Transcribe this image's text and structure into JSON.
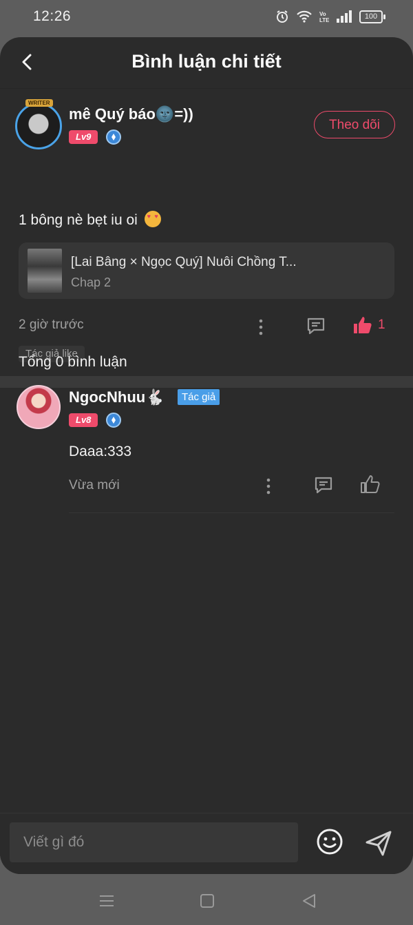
{
  "status_bar": {
    "time": "12:26",
    "battery": "100",
    "icons": [
      "alarm-icon",
      "wifi-icon",
      "volte-icon",
      "signal-icon",
      "battery-icon"
    ]
  },
  "header": {
    "title": "Bình luận chi tiết",
    "back_icon": "chevron-left-icon"
  },
  "post": {
    "username": "mê Quý báo🌚=))",
    "avatar_badge": "WRITER",
    "level": "Lv9",
    "follow_label": "Theo dõi",
    "text": "1 bông nè bẹt iu oi",
    "emoji": "heart-eyes-cat-emoji",
    "story": {
      "title": "[Lai Bâng × Ngọc Quý] Nuôi Chồng T...",
      "chapter": "Chap 2"
    },
    "time_ago": "2 giờ trước",
    "like_count": "1",
    "author_like": "Tác giả like"
  },
  "replies": {
    "total_label": "Tổng 0 bình luận",
    "items": [
      {
        "username": "NgocNhuu🐇",
        "author_tag": "Tác giả",
        "level": "Lv8",
        "text": "Daaa:333",
        "time": "Vừa mới"
      }
    ]
  },
  "input": {
    "placeholder": "Viết gì đó"
  },
  "colors": {
    "accent": "#ef4b6b",
    "author_tag": "#4a9ee8",
    "panel_bg": "#2b2b2b",
    "outer_bg": "#5d5d5d"
  }
}
